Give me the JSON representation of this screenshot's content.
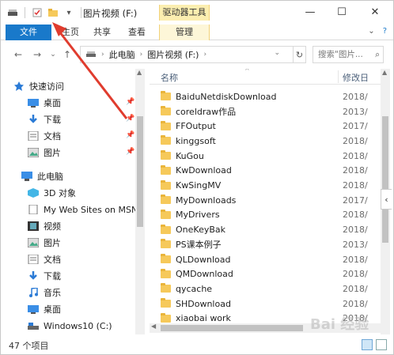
{
  "window": {
    "title": "图片视频 (F:)",
    "context_tab_title": "驱动器工具",
    "controls": {
      "minimize": "—",
      "maximize": "☐",
      "close": "✕"
    }
  },
  "ribbon": {
    "tabs": [
      "文件",
      "主页",
      "共享",
      "查看",
      "管理"
    ],
    "file_tab_color": "#1979ca"
  },
  "address": {
    "path": [
      "此电脑",
      "图片视频 (F:)"
    ],
    "search_placeholder": "搜索\"图片..."
  },
  "nav": {
    "quick_access": "快速访问",
    "quick_items": [
      "桌面",
      "下载",
      "文档",
      "图片"
    ],
    "this_pc": "此电脑",
    "pc_items": [
      "3D 对象",
      "My Web Sites on MSN",
      "视频",
      "图片",
      "文档",
      "下载",
      "音乐",
      "桌面",
      "Windows10 (C:)"
    ]
  },
  "filelist": {
    "col_name": "名称",
    "col_date": "修改日",
    "rows": [
      {
        "name": "BaiduNetdiskDownload",
        "date": "2018/"
      },
      {
        "name": "coreldraw作品",
        "date": "2013/"
      },
      {
        "name": "FFOutput",
        "date": "2017/"
      },
      {
        "name": "kinggsoft",
        "date": "2018/"
      },
      {
        "name": "KuGou",
        "date": "2018/"
      },
      {
        "name": "KwDownload",
        "date": "2018/"
      },
      {
        "name": "KwSingMV",
        "date": "2018/"
      },
      {
        "name": "MyDownloads",
        "date": "2017/"
      },
      {
        "name": "MyDrivers",
        "date": "2018/"
      },
      {
        "name": "OneKeyBak",
        "date": "2018/"
      },
      {
        "name": "PS课本例子",
        "date": "2013/"
      },
      {
        "name": "QLDownload",
        "date": "2018/"
      },
      {
        "name": "QMDownload",
        "date": "2018/"
      },
      {
        "name": "qycache",
        "date": "2018/"
      },
      {
        "name": "SHDownload",
        "date": "2018/"
      },
      {
        "name": "xiaobai work",
        "date": "2018/"
      }
    ]
  },
  "status": {
    "item_count": "47 个项目"
  },
  "annotation": {
    "arrow_color": "#e03c2e"
  },
  "watermark": "Bai 经验"
}
